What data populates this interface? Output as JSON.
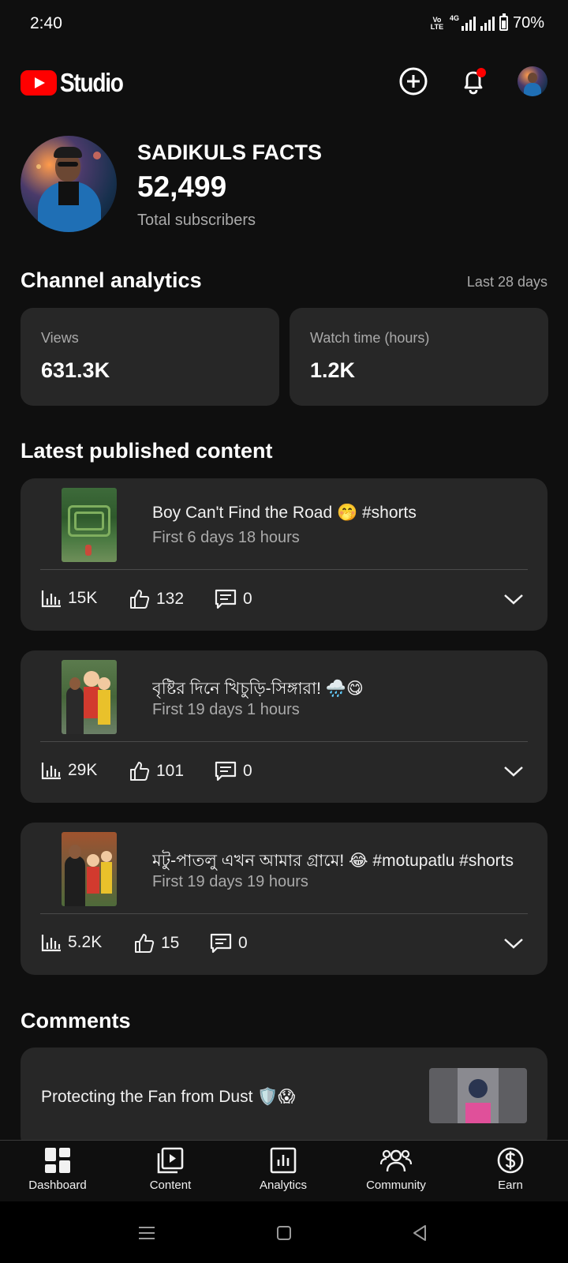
{
  "status_bar": {
    "time": "2:40",
    "volte": "Vo\nLTE",
    "network": "4G",
    "battery": "70%"
  },
  "header": {
    "logo_text": "Studio",
    "icons": [
      "create-icon",
      "notifications-icon",
      "account-avatar"
    ]
  },
  "channel": {
    "name": "SADIKULS FACTS",
    "subscriber_count": "52,499",
    "subscriber_label": "Total subscribers"
  },
  "analytics": {
    "title": "Channel analytics",
    "period": "Last 28 days",
    "cards": [
      {
        "label": "Views",
        "value": "631.3K"
      },
      {
        "label": "Watch time (hours)",
        "value": "1.2K"
      }
    ]
  },
  "latest": {
    "title": "Latest published content",
    "videos": [
      {
        "title": "Boy Can't Find the Road 🤭 #shorts",
        "subtitle": "First 6 days 18 hours",
        "views": "15K",
        "likes": "132",
        "comments": "0"
      },
      {
        "title": "বৃষ্টির দিনে খিচুড়ি-সিঙ্গারা! 🌧️😋",
        "subtitle": "First 19 days 1 hours",
        "views": "29K",
        "likes": "101",
        "comments": "0"
      },
      {
        "title": "মটু-পাতলু এখন আমার গ্রামে! 😂 #motupatlu #shorts",
        "subtitle": "First 19 days 19 hours",
        "views": "5.2K",
        "likes": "15",
        "comments": "0"
      }
    ]
  },
  "comments": {
    "title": "Comments",
    "items": [
      {
        "text": "Protecting the Fan from Dust 🛡️😱"
      }
    ]
  },
  "bottom_nav": {
    "items": [
      {
        "label": "Dashboard",
        "icon": "dashboard-icon"
      },
      {
        "label": "Content",
        "icon": "content-icon"
      },
      {
        "label": "Analytics",
        "icon": "analytics-icon"
      },
      {
        "label": "Community",
        "icon": "community-icon"
      },
      {
        "label": "Earn",
        "icon": "earn-icon"
      }
    ]
  },
  "colors": {
    "background": "#0f0f0f",
    "card": "#272727",
    "brand_red": "#ff0000",
    "secondary_text": "#aaaaaa"
  }
}
